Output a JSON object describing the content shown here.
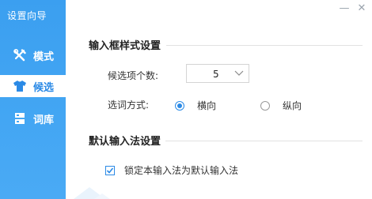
{
  "app": {
    "title": "设置向导"
  },
  "window_controls": {
    "minimize": "—",
    "close": "✕"
  },
  "sidebar": {
    "items": [
      {
        "label": "模式",
        "icon": "tools-icon",
        "active": false
      },
      {
        "label": "候选",
        "icon": "shirt-icon",
        "active": true
      },
      {
        "label": "词库",
        "icon": "database-icon",
        "active": false
      }
    ]
  },
  "input_box_style": {
    "title": "输入框样式设置",
    "candidate_count": {
      "label": "候选项个数:",
      "value": "5"
    },
    "select_mode": {
      "label": "选词方式:",
      "options": [
        {
          "label": "横向",
          "selected": true
        },
        {
          "label": "纵向",
          "selected": false
        }
      ]
    }
  },
  "default_ime": {
    "title": "默认输入法设置",
    "lock_checkbox": {
      "label": "锁定本输入法为默认输入法",
      "checked": true
    }
  },
  "colors": {
    "accent": "#2b8ae6",
    "sidebar": "#43a6f3"
  }
}
